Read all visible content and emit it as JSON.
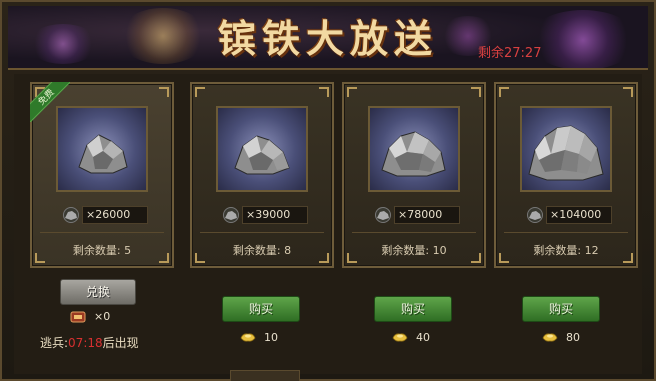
{
  "header": {
    "title": "镔铁大放送",
    "countdown": "剩余27:27"
  },
  "cards": [
    {
      "badge": "免费",
      "amount": "×26000",
      "remaining": "剩余数量: 5"
    },
    {
      "amount": "×39000",
      "remaining": "剩余数量: 8",
      "buy_label": "购买",
      "price": "10"
    },
    {
      "amount": "×78000",
      "remaining": "剩余数量: 10",
      "buy_label": "购买",
      "price": "40"
    },
    {
      "amount": "×104000",
      "remaining": "剩余数量: 12",
      "buy_label": "购买",
      "price": "80"
    }
  ],
  "free_panel": {
    "exchange_label": "兑换",
    "token_count": "×0",
    "deserter_prefix": "逃兵:",
    "deserter_time": "07:18",
    "deserter_suffix": "后出现"
  },
  "icons": {
    "ore": "iron-ore-icon",
    "token": "exchange-token-icon",
    "currency": "gold-ingot-icon"
  },
  "colors": {
    "title": "#f2d9a2",
    "countdown": "#d84040",
    "buy_button": "#3f8a32",
    "exchange_button": "#8a8882",
    "badge": "#2f7a2a"
  }
}
